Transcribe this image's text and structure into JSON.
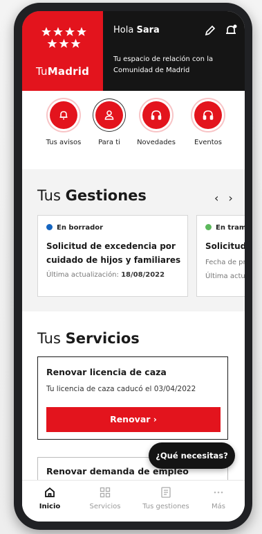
{
  "header": {
    "logo_prefix": "Tu",
    "logo_bold": "Madrid",
    "greeting": "Hola",
    "user_name": "Sara",
    "tagline": "Tu espacio de relación con la Comunidad de Madrid"
  },
  "quick_actions": [
    {
      "label": "Tus avisos",
      "icon": "bell-icon"
    },
    {
      "label": "Para ti",
      "icon": "user-icon"
    },
    {
      "label": "Novedades",
      "icon": "headphones-icon"
    },
    {
      "label": "Eventos",
      "icon": "headphones-icon"
    }
  ],
  "gestiones": {
    "title_prefix": "Tus",
    "title_bold": "Gestiones",
    "prev": "‹",
    "next": "›",
    "cards": [
      {
        "status": "En borrador",
        "status_color": "#1565c0",
        "title": "Solicitud de excedencia por cuidado de hijos y familiares",
        "meta_label": "Última actualización:",
        "meta_value": "18/08/2022"
      },
      {
        "status": "En tramita",
        "status_color": "#5cb85c",
        "title": "Solicitud de",
        "meta_line1": "Fecha de pres",
        "meta_line2": "Última actual"
      }
    ]
  },
  "servicios": {
    "title_prefix": "Tus",
    "title_bold": "Servicios",
    "card1": {
      "title": "Renovar licencia de caza",
      "subtitle": "Tu licencia de caza caducó el 03/04/2022",
      "button": "Renovar  ›"
    },
    "card2": {
      "title": "Renovar demanda de empleo"
    }
  },
  "help_button": "¿Qué necesitas?",
  "tabs": [
    {
      "label": "Inicio",
      "icon": "home-icon",
      "active": true
    },
    {
      "label": "Servicios",
      "icon": "grid-icon",
      "active": false
    },
    {
      "label": "Tus gestiones",
      "icon": "document-icon",
      "active": false
    },
    {
      "label": "Más",
      "icon": "more-icon",
      "active": false
    }
  ],
  "colors": {
    "brand_red": "#e3141d",
    "header_dark": "#151515"
  }
}
